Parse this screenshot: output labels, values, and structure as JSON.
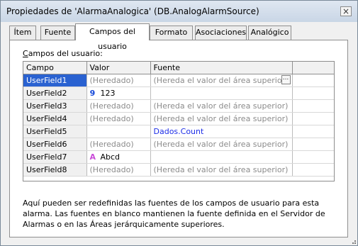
{
  "window": {
    "title": "Propiedades de 'AlarmaAnalogica' (DB.AnalogAlarmSource)",
    "close_label": "×"
  },
  "tabs": [
    {
      "label": "Ítem"
    },
    {
      "label": "Fuente"
    },
    {
      "label": "Campos del usuario"
    },
    {
      "label": "Formato"
    },
    {
      "label": "Asociaciones"
    },
    {
      "label": "Analógico"
    }
  ],
  "section": {
    "label_prefix": "C",
    "label_rest": "ampos del usuario:"
  },
  "table": {
    "headers": [
      "Campo",
      "Valor",
      "Fuente",
      ""
    ],
    "rows": [
      {
        "field": "UserField1",
        "value": "(Heredado)",
        "source": "(Hereda el valor del área superior)"
      },
      {
        "field": "UserField2",
        "value": "123",
        "source": ""
      },
      {
        "field": "UserField3",
        "value": "(Heredado)",
        "source": "(Hereda el valor del área superior)"
      },
      {
        "field": "UserField4",
        "value": "(Heredado)",
        "source": "(Hereda el valor del área superior)"
      },
      {
        "field": "UserField5",
        "value": "",
        "source": "Dados.Count"
      },
      {
        "field": "UserField6",
        "value": "(Heredado)",
        "source": "(Hereda el valor del área superior)"
      },
      {
        "field": "UserField7",
        "value": "Abcd",
        "source": ""
      },
      {
        "field": "UserField8",
        "value": "(Heredado)",
        "source": "(Hereda el valor del área superior)"
      }
    ]
  },
  "icons": {
    "number_icon": "9",
    "text_icon": "A"
  },
  "info_text": "Aquí pueden ser redefinidas las fuentes de los campos de usuario para esta alarma. Las fuentes en blanco mantienen la fuente definida en el Servidor de Alarmas o en las Áreas jerárquicamente superiores.",
  "browse_button_label": "..."
}
